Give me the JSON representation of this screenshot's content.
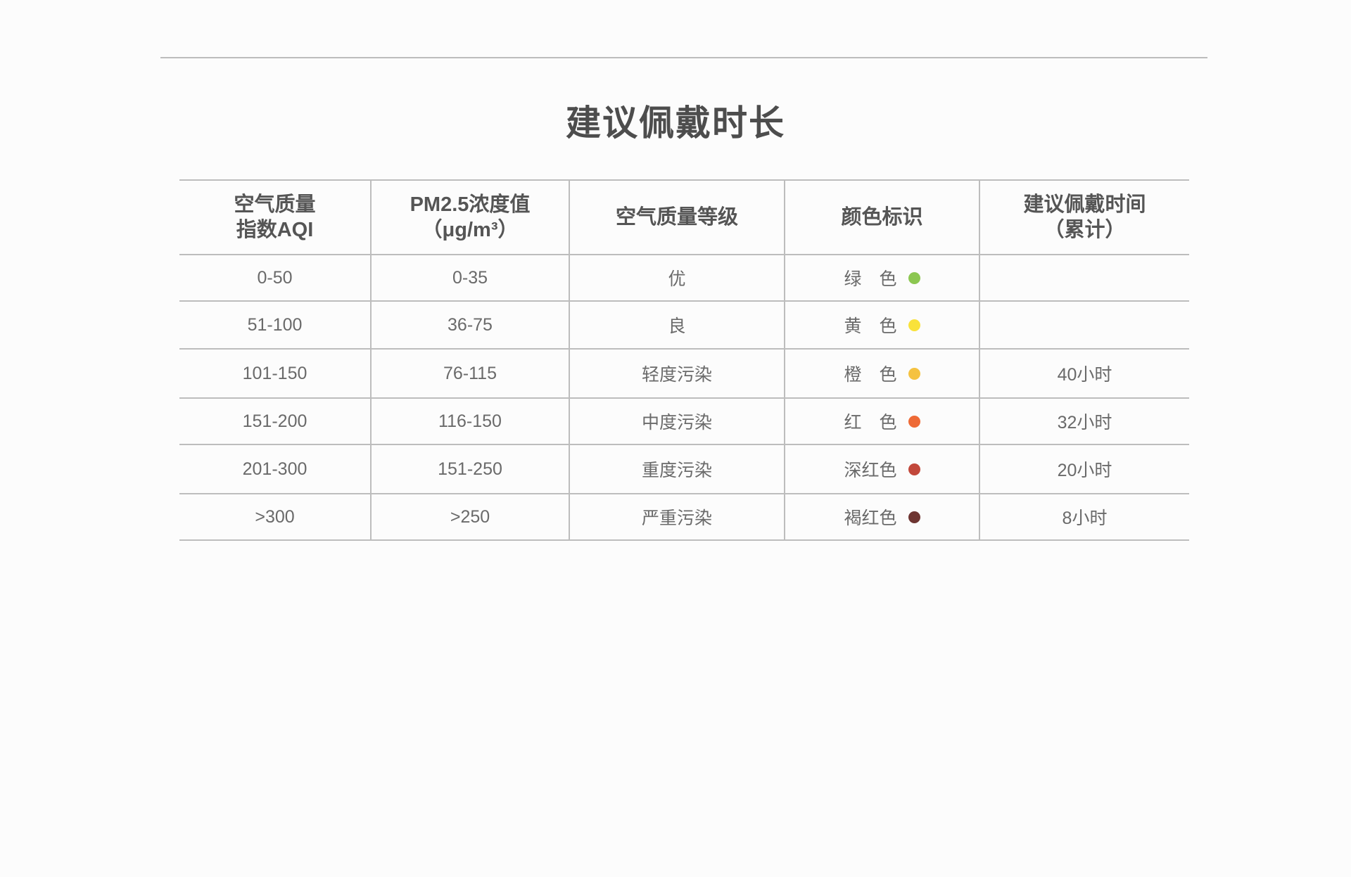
{
  "title": "建议佩戴时长",
  "table": {
    "headers": [
      [
        "空气质量",
        "指数AQI"
      ],
      [
        "PM2.5浓度值",
        "（μg/m³）"
      ],
      [
        "空气质量等级"
      ],
      [
        "颜色标识"
      ],
      [
        "建议佩戴时间",
        "（累计）"
      ]
    ],
    "rows": [
      {
        "aqi": "0-50",
        "pm25": "0-35",
        "level": "优",
        "color_name": "绿　色",
        "color_hex": "#8cc751",
        "duration": ""
      },
      {
        "aqi": "51-100",
        "pm25": "36-75",
        "level": "良",
        "color_name": "黄　色",
        "color_hex": "#f9e23a",
        "duration": ""
      },
      {
        "aqi": "101-150",
        "pm25": "76-115",
        "level": "轻度污染",
        "color_name": "橙　色",
        "color_hex": "#f5c240",
        "duration": "40小时"
      },
      {
        "aqi": "151-200",
        "pm25": "116-150",
        "level": "中度污染",
        "color_name": "红　色",
        "color_hex": "#ee6a36",
        "duration": "32小时"
      },
      {
        "aqi": "201-300",
        "pm25": "151-250",
        "level": "重度污染",
        "color_name": "深红色",
        "color_hex": "#c2483b",
        "duration": "20小时"
      },
      {
        "aqi": ">300",
        "pm25": ">250",
        "level": "严重污染",
        "color_name": "褐红色",
        "color_hex": "#6e3532",
        "duration": "8小时"
      }
    ]
  }
}
